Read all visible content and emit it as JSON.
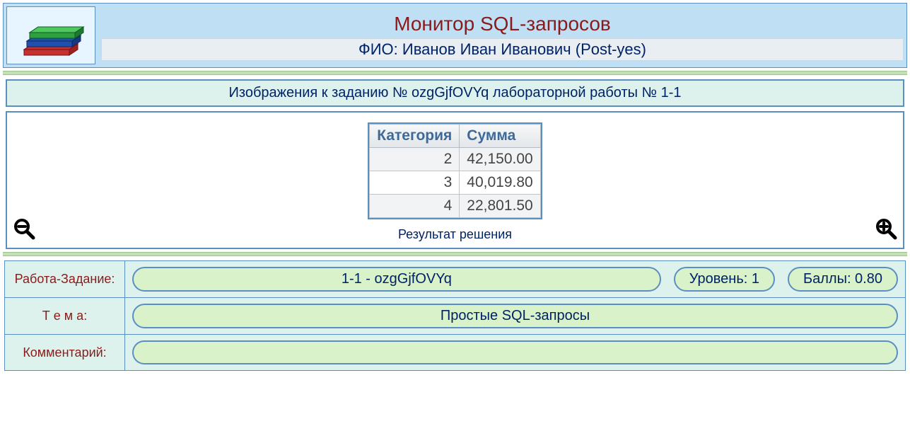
{
  "header": {
    "title": "Монитор SQL-запросов",
    "user_line": "ФИО: Иванов Иван Иванович (Post-yes)"
  },
  "subtitle": "Изображения к заданию № ozgGjfOVYq лабораторной работы № 1-1",
  "result": {
    "col1": "Категория",
    "col2": "Сумма",
    "rows": [
      {
        "c": "2",
        "s": "42,150.00"
      },
      {
        "c": "3",
        "s": "40,019.80"
      },
      {
        "c": "4",
        "s": "22,801.50"
      }
    ],
    "caption": "Результат решения"
  },
  "info": {
    "label_work": "Работа-Задание:",
    "label_topic": "Т е м а:",
    "label_comment": "Комментарий:",
    "work_task": "1-1 - ozgGjfOVYq",
    "level": "Уровень: 1",
    "points": "Баллы: 0.80",
    "topic": "Простые SQL-запросы",
    "comment": ""
  }
}
